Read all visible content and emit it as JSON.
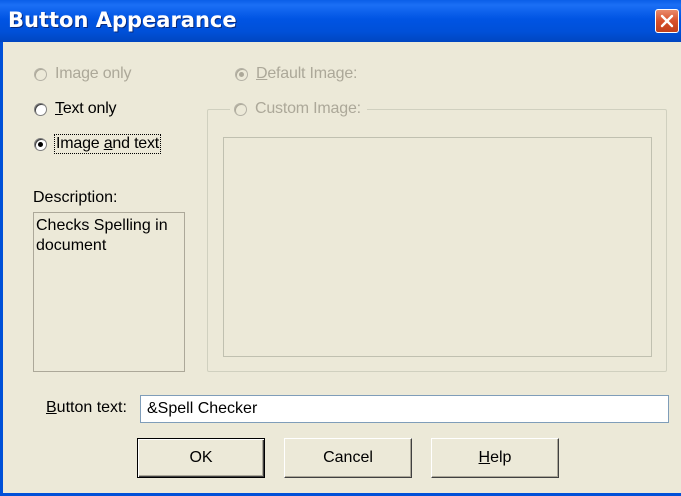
{
  "window": {
    "title": "Button Appearance",
    "close_icon": "close-icon"
  },
  "display_mode": {
    "options": [
      {
        "id": "image-only",
        "label": "Image only",
        "selected": false,
        "enabled": false
      },
      {
        "id": "text-only",
        "label": "Text only",
        "selected": false,
        "enabled": true
      },
      {
        "id": "image-and-text",
        "label": "Image and text",
        "selected": true,
        "enabled": true
      }
    ]
  },
  "image_source": {
    "default_image_label": "Default Image:",
    "custom_image_label": "Custom Image:",
    "default_selected": true,
    "enabled": false
  },
  "description": {
    "label": "Description:",
    "text": "Checks Spelling in document"
  },
  "button_text": {
    "label": "Button text:",
    "value": "&Spell Checker"
  },
  "buttons": {
    "ok": "OK",
    "cancel": "Cancel",
    "help": "Help"
  },
  "colors": {
    "title_bar": "#0054e3",
    "dialog_background": "#ece9d8",
    "disabled_text": "#aca899"
  }
}
